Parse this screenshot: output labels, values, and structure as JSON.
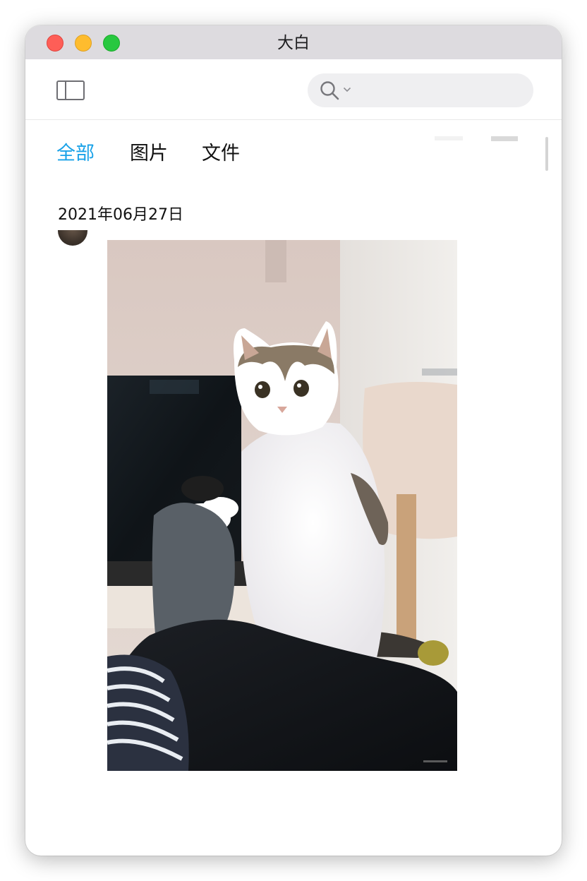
{
  "window": {
    "title": "大白"
  },
  "toolbar": {
    "search": {
      "placeholder": "",
      "value": ""
    }
  },
  "tabs": [
    {
      "label": "全部",
      "active": true
    },
    {
      "label": "图片",
      "active": false
    },
    {
      "label": "文件",
      "active": false
    }
  ],
  "feed": {
    "date_label": "2021年06月27日"
  },
  "colors": {
    "accent": "#1aa2e8",
    "close": "#fe5e57",
    "minimize": "#febc2e",
    "maximize": "#28c840"
  },
  "icons": [
    "close-button",
    "minimize-button",
    "maximize-button",
    "sidebar-toggle-icon",
    "search-icon",
    "chevron-down-icon"
  ]
}
